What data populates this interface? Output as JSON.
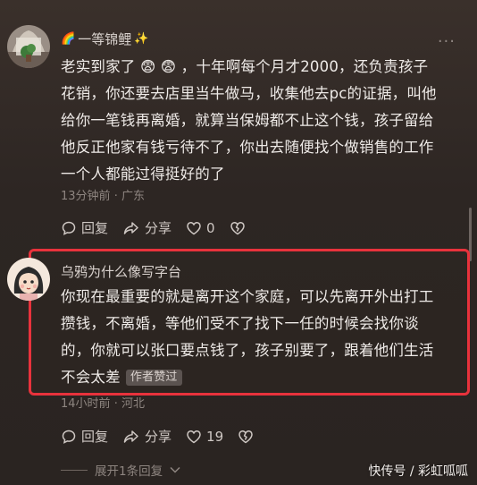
{
  "comments": [
    {
      "username": "一等锦鲤",
      "prefix_emoji": "🌈",
      "suffix_emoji": "✨",
      "content_lines": [
        "老实到家了 😨 😨 ，十年啊每个月才2000，还负责孩子",
        "花销，你还要去店里当牛做马，收集他去pc的证据，叫他",
        "给你一笔钱再离婚，就算当保姆都不止这个钱，孩子留给",
        "他反正他家有钱亏待不了，你出去随便找个做销售的工作",
        "一个人都能过得挺好的了"
      ],
      "time": "13分钟前",
      "location": "广东",
      "reply_label": "回复",
      "share_label": "分享",
      "like_count": "0",
      "more": "···"
    },
    {
      "username": "乌鸦为什么像写字台",
      "content_lines": [
        "你现在最重要的就是离开这个家庭，可以先离开外出打工",
        "攒钱，不离婚，等他们受不了找下一任的时候会找你谈",
        "的，你就可以张口要点钱了，孩子别要了，跟着他们生活",
        "不会太差"
      ],
      "badge": "作者赞过",
      "time": "14小时前",
      "location": "河北",
      "reply_label": "回复",
      "share_label": "分享",
      "like_count": "19",
      "expand_label": "展开1条回复"
    }
  ],
  "watermark": "快传号 / 彩虹呱呱",
  "colors": {
    "highlight": "#e8323c",
    "background": "#2f2824"
  }
}
